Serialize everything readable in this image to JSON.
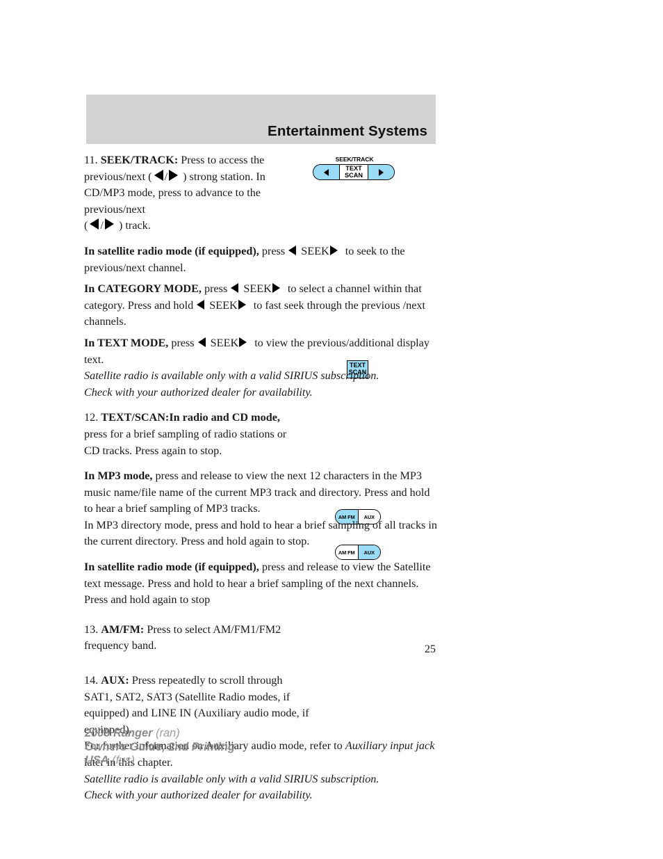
{
  "header": {
    "title": "Entertainment Systems",
    "band_color": "#d2d2d2"
  },
  "accent_color": "#9adcf5",
  "figures": {
    "seek_track": {
      "label": "SEEK/TRACK",
      "center_line1": "TEXT",
      "center_line2": "SCAN",
      "left_icon": "triangle-left-icon",
      "right_icon": "triangle-right-icon"
    },
    "text_scan": {
      "line1": "TEXT",
      "line2": "SCAN"
    },
    "am_fm": {
      "left_label": "AM FM",
      "right_label": "AUX",
      "highlighted": "AM FM"
    },
    "aux": {
      "left_label": "AM FM",
      "right_label": "AUX",
      "highlighted": "AUX"
    }
  },
  "body": {
    "item11": {
      "number": "11.",
      "term": "SEEK/TRACK:",
      "t1": " Press to access the previous/next (",
      "sep": "/",
      "t2": " ) strong station. In CD/MP3 mode, press to advance to the previous/next",
      "t3": "(",
      "t4": " ) track."
    },
    "satellite_seek": {
      "lead": "In satellite radio mode (if equipped),",
      "t1": " press ",
      "seek": "SEEK",
      "t2": " to seek to the previous/next channel."
    },
    "category_mode": {
      "lead": "In CATEGORY MODE,",
      "t1": " press ",
      "seek": "SEEK",
      "t2": " to select a channel within that category. Press and hold ",
      "seek2": "SEEK",
      "t3": " to fast seek through the previous /next channels."
    },
    "text_mode": {
      "lead": "In TEXT MODE,",
      "t1": " press ",
      "seek": "SEEK",
      "t2": " to view the previous/additional display text."
    },
    "note1": {
      "line1": "Satellite radio is available only with a valid SIRIUS subscription.",
      "line2": "Check with your authorized dealer for availability."
    },
    "item12": {
      "number": "12.",
      "term": "TEXT/SCAN:In radio and CD mode,",
      "t1": " press for a brief sampling of radio stations or CD tracks. Press again to stop."
    },
    "mp3_mode": {
      "lead": "In MP3 mode,",
      "t1": " press and release to view the next 12 characters in the MP3 music name/file name of the current MP3 track and directory. Press and hold to hear a brief sampling of MP3 tracks.",
      "t2": "In MP3 directory mode, press and hold to hear a brief sampling of all tracks in the current directory. Press and hold again to stop."
    },
    "satellite_text": {
      "lead": "In satellite radio mode (if equipped),",
      "t1": " press and release to view the Satellite text message. Press and hold to hear a brief sampling of the next channels. Press and hold again to stop"
    },
    "item13": {
      "number": "13.",
      "term": "AM/FM:",
      "t1": " Press to select AM/FM1/FM2 frequency band."
    },
    "item14": {
      "number": "14.",
      "term": "AUX:",
      "t1": " Press repeatedly to scroll through SAT1, SAT2, SAT3 (Satellite Radio modes, if equipped) and LINE IN (Auxiliary audio mode, if equipped).",
      "t2": "For further information on Auxiliary audio mode, refer to ",
      "italic": "Auxiliary input jack",
      "t3": " later in this chapter."
    },
    "note2": {
      "line1": "Satellite radio is available only with a valid SIRIUS subscription.",
      "line2": "Check with your authorized dealer for availability."
    }
  },
  "page_number": "25",
  "footer": {
    "line1_strong": "2009 Ranger",
    "line1_light": "(ran)",
    "line2_strong": "Owners Guide, 2nd Printing",
    "line3_strong": "USA",
    "line3_light": "(fus)"
  }
}
